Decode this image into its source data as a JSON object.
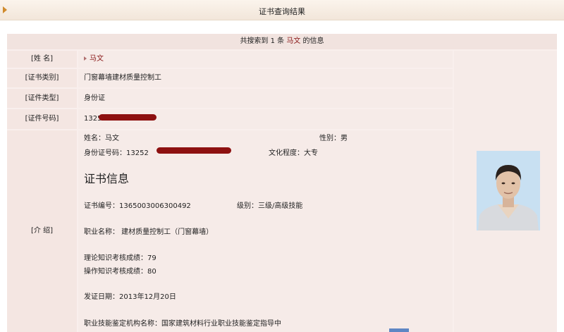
{
  "header": {
    "title": "证书查询结果"
  },
  "summary": {
    "prefix": "共搜索到 1 条",
    "name": "马文",
    "suffix": "的信息"
  },
  "rows": {
    "name": {
      "label": "[姓 名]",
      "value": "马文"
    },
    "cert_type": {
      "label": "[证书类别]",
      "value": "门窗幕墙建材质量控制工"
    },
    "id_type": {
      "label": "[证件类型]",
      "value": "身份证"
    },
    "id_number": {
      "label": "[证件号码]",
      "value": "1325"
    }
  },
  "intro": {
    "label": "[介 绍]",
    "name_line": "姓名：马文",
    "gender_line": "性别：男",
    "id_line": "身份证号码：13252",
    "education_line": "文化程度：大专",
    "section_title": "证书信息",
    "cert_no_line": "证书编号：1365003006300492",
    "level_line": "级别：三级/高级技能",
    "job_line": "职业名称： 建材质量控制工（门窗幕墙）",
    "theory_line": "理论知识考核成绩：79",
    "practice_line": "操作知识考核成绩：80",
    "issue_date_line": "发证日期：2013年12月20日",
    "org_line": "职业技能鉴定机构名称：国家建筑材料行业职业技能鉴定指导中"
  },
  "colors": {
    "accent": "#d08a2c",
    "highlight": "#8b1a1a",
    "redaction": "#8d1010"
  },
  "icons": {
    "header_marker": "triangle-right-icon",
    "name_marker": "small-triangle-icon"
  }
}
